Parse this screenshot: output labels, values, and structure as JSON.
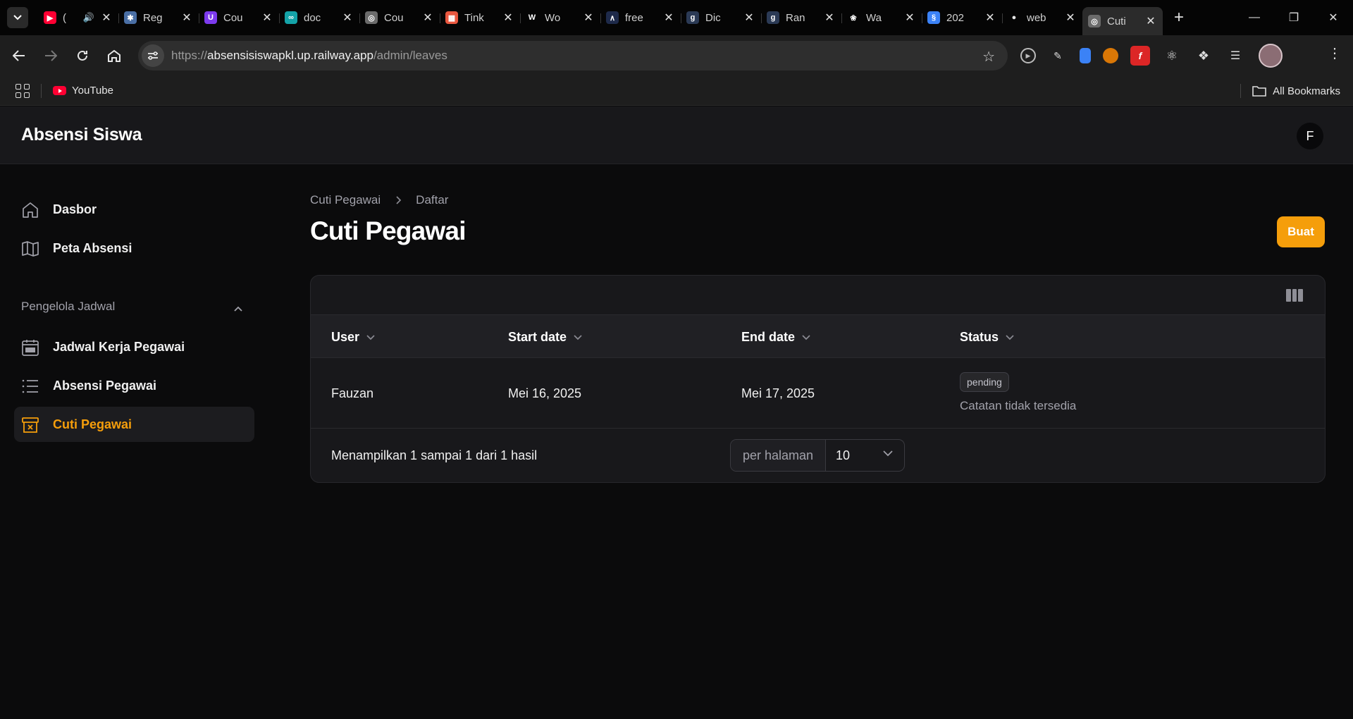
{
  "browser": {
    "tabs": [
      {
        "title": "(",
        "icon": "youtube",
        "color": "#ff0033",
        "audio": true
      },
      {
        "title": "Reg",
        "icon": "puzzle",
        "color": "#4a6fa5"
      },
      {
        "title": "Cou",
        "icon": "u-logo",
        "color": "#7c3aed"
      },
      {
        "title": "doc",
        "icon": "arduino",
        "color": "#14a3a8"
      },
      {
        "title": "Cou",
        "icon": "globe",
        "color": "#6b6b6b"
      },
      {
        "title": "Tink",
        "icon": "tinkercad",
        "color": "#e9573f"
      },
      {
        "title": "Wo",
        "icon": "wikipedia",
        "color": "#ffffff"
      },
      {
        "title": "free",
        "icon": "code",
        "color": "#1e2a4a"
      },
      {
        "title": "Dic",
        "icon": "g-logo",
        "color": "#2b3a55"
      },
      {
        "title": "Ran",
        "icon": "g-logo",
        "color": "#2b3a55"
      },
      {
        "title": "Wa",
        "icon": "openai",
        "color": "#ffffff"
      },
      {
        "title": "202",
        "icon": "figure",
        "color": "#3b82f6"
      },
      {
        "title": "web",
        "icon": "speech",
        "color": "#e5e5e5"
      },
      {
        "title": "Cuti",
        "icon": "globe",
        "color": "#6b6b6b",
        "active": true
      }
    ],
    "url_scheme": "https://",
    "url_host": "absensisiswapkl.up.railway.app",
    "url_path": "/admin/leaves",
    "bookmarks": [
      {
        "label": "YouTube",
        "icon": "youtube"
      }
    ],
    "all_bookmarks_label": "All Bookmarks"
  },
  "app": {
    "brand": "Absensi Siswa",
    "user_initial": "F"
  },
  "sidebar": {
    "items": [
      {
        "label": "Dasbor",
        "icon": "home-icon"
      },
      {
        "label": "Peta Absensi",
        "icon": "map-icon"
      }
    ],
    "group_label": "Pengelola Jadwal",
    "group_items": [
      {
        "label": "Jadwal Kerja Pegawai",
        "icon": "calendar-icon"
      },
      {
        "label": "Absensi Pegawai",
        "icon": "list-icon"
      },
      {
        "label": "Cuti Pegawai",
        "icon": "archive-x-icon",
        "active": true
      }
    ]
  },
  "main": {
    "breadcrumb": [
      "Cuti Pegawai",
      "Daftar"
    ],
    "title": "Cuti Pegawai",
    "create_label": "Buat",
    "accent": "#f59e0b",
    "table": {
      "columns": [
        "User",
        "Start date",
        "End date",
        "Status"
      ],
      "rows": [
        {
          "user": "Fauzan",
          "start": "Mei 16, 2025",
          "end": "Mei 17, 2025",
          "status": "pending",
          "note": "Catatan tidak tersedia"
        }
      ]
    },
    "pagination": {
      "summary": "Menampilkan 1 sampai 1 dari 1 hasil",
      "per_page_label": "per halaman",
      "per_page_value": "10"
    }
  }
}
